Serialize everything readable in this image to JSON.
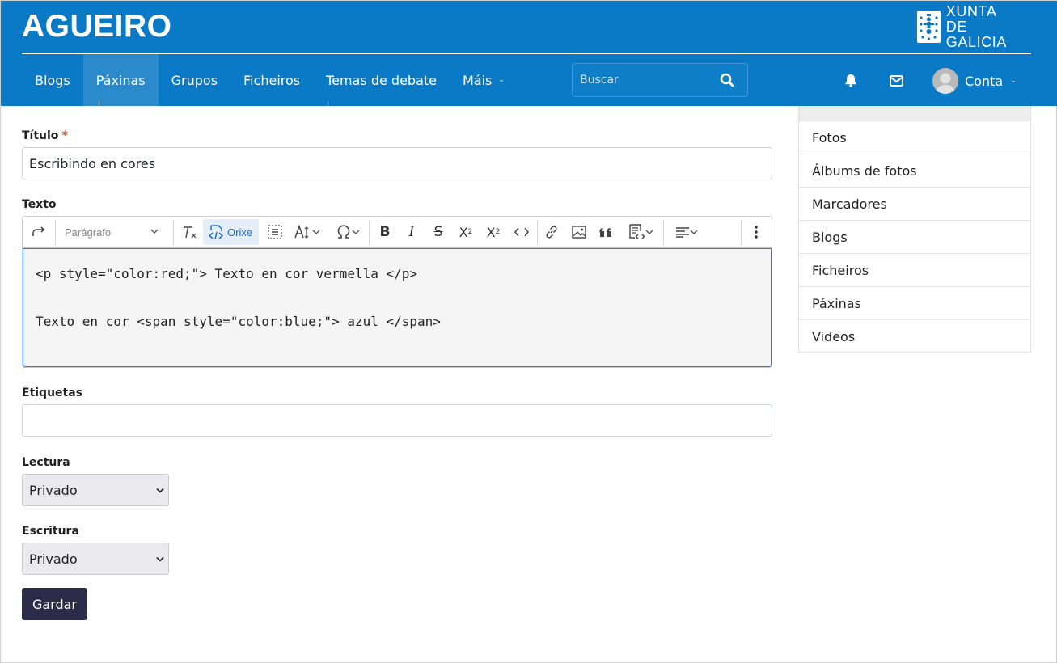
{
  "header": {
    "site_title": "AGUEIRO",
    "logo": {
      "line1": "XUNTA",
      "line2": "DE GALICIA",
      "icon": "xunta-emblem"
    },
    "nav": [
      {
        "label": "Blogs",
        "active": false
      },
      {
        "label": "Páxinas",
        "active": true
      },
      {
        "label": "Grupos",
        "active": false
      },
      {
        "label": "Ficheiros",
        "active": false
      },
      {
        "label": "Temas de debate",
        "active": false
      },
      {
        "label": "Máis",
        "active": false,
        "dropdown": true
      }
    ],
    "search": {
      "placeholder": "Buscar",
      "value": "",
      "icon": "search-icon"
    },
    "notifications_icon": "bell-icon",
    "messages_icon": "envelope-icon",
    "account": {
      "label": "Conta",
      "icon": "avatar"
    }
  },
  "form": {
    "title": {
      "label": "Título",
      "required_mark": "*",
      "value": "Escribindo en cores"
    },
    "text": {
      "label": "Texto",
      "toolbar": {
        "undo_icon": "redo-icon",
        "heading_value": "Parágrafo",
        "source_label": "Orixe",
        "icons": [
          "remove-format-icon",
          "source-editing-icon",
          "select-all-icon",
          "font-size-icon",
          "special-characters-icon",
          "bold-icon",
          "italic-icon",
          "strikethrough-icon",
          "subscript-icon",
          "superscript-icon",
          "code-icon",
          "link-icon",
          "image-icon",
          "blockquote-icon",
          "html-embed-icon",
          "align-icon",
          "more-icon"
        ]
      },
      "source_lines": [
        "<p style=\"color:red;\"> Texto en cor vermella </p>",
        "Texto en cor <span style=\"color:blue;\"> azul </span>"
      ]
    },
    "tags": {
      "label": "Etiquetas",
      "value": ""
    },
    "read_access": {
      "label": "Lectura",
      "value": "Privado"
    },
    "write_access": {
      "label": "Escritura",
      "value": "Privado"
    },
    "save_label": "Gardar"
  },
  "sidebar": {
    "items": [
      "Fotos",
      "Álbums de fotos",
      "Marcadores",
      "Blogs",
      "Ficheiros",
      "Páxinas",
      "Videos"
    ]
  },
  "colors": {
    "header_bg": "#0a7ac6",
    "nav_active_bg": "#2a8acb",
    "save_button_bg": "#2c2c4a",
    "required": "#d9463c",
    "source_active": "#1a6ecf",
    "editor_focus": "#2977ff"
  }
}
